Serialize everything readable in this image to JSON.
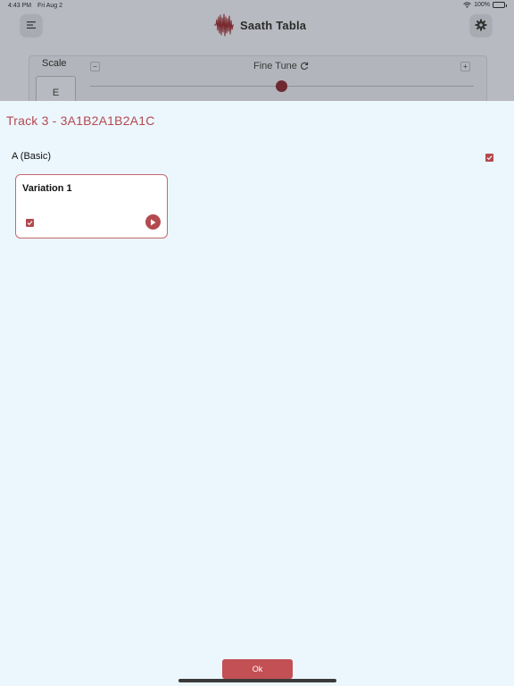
{
  "status_bar": {
    "time": "4:43 PM",
    "date": "Fri Aug 2",
    "battery": "100%"
  },
  "header": {
    "app_title": "Saath Tabla"
  },
  "controls": {
    "scale_label": "Scale",
    "scale_value": "E",
    "fine_tune_label": "Fine Tune",
    "minus_label": "−",
    "plus_label": "+",
    "fine_tune_level": 0.5
  },
  "sheet": {
    "track_title": "Track 3 - 3A1B2A1B2A1C",
    "section": {
      "title": "A (Basic)",
      "checked": true
    },
    "variations": [
      {
        "title": "Variation 1",
        "checked": true
      }
    ],
    "ok_label": "Ok"
  },
  "colors": {
    "accent": "#b24a4f",
    "sheet_background": "#ecf6fd",
    "dimmed_background": "#b7bac0"
  },
  "icons": [
    "menu-icon",
    "waveform-logo-icon",
    "gear-icon",
    "refresh-icon",
    "checkbox-icon",
    "play-icon",
    "wifi-icon",
    "battery-icon"
  ]
}
